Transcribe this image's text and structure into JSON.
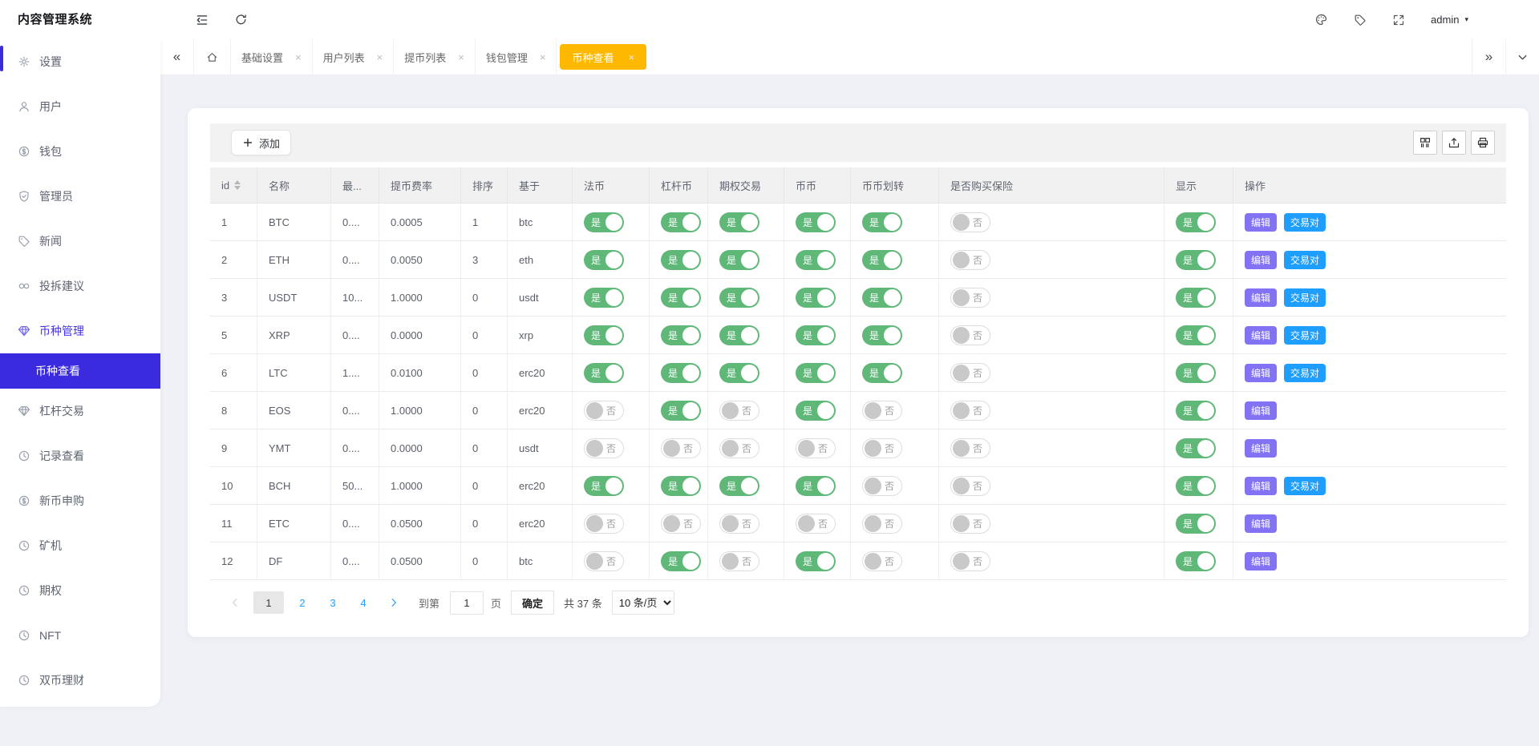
{
  "app": {
    "title": "内容管理系统",
    "user": "admin"
  },
  "header": {
    "left_icons": [
      {
        "icon": "collapse-icon"
      },
      {
        "icon": "refresh-icon"
      }
    ],
    "right_icons": [
      {
        "icon": "palette-icon"
      },
      {
        "icon": "tag-icon"
      },
      {
        "icon": "fullscreen-icon"
      }
    ]
  },
  "tabbar": {
    "tabs": [
      {
        "key": "basic-settings",
        "label": "基础设置",
        "active": false
      },
      {
        "key": "user-list",
        "label": "用户列表",
        "active": false
      },
      {
        "key": "withdraw-list",
        "label": "提币列表",
        "active": false
      },
      {
        "key": "wallet-manage",
        "label": "钱包管理",
        "active": false
      },
      {
        "key": "coin-view",
        "label": "币种查看",
        "active": true
      }
    ]
  },
  "sidebar": {
    "items": [
      {
        "key": "settings",
        "icon": "gear-icon",
        "label": "设置"
      },
      {
        "key": "users",
        "icon": "user-icon",
        "label": "用户"
      },
      {
        "key": "wallet",
        "icon": "dollar-circle-icon",
        "label": "钱包"
      },
      {
        "key": "admins",
        "icon": "shield-check-icon",
        "label": "管理员"
      },
      {
        "key": "news",
        "icon": "tag-icon",
        "label": "新闻"
      },
      {
        "key": "suggestions",
        "icon": "link-icon",
        "label": "投拆建议"
      },
      {
        "key": "coin-manage",
        "icon": "diamond-icon",
        "label": "币种管理",
        "active_parent": true,
        "children": [
          {
            "key": "coin-view",
            "label": "币种查看",
            "active": true
          }
        ]
      },
      {
        "key": "leverage-trade",
        "icon": "diamond-icon",
        "label": "杠杆交易"
      },
      {
        "key": "records",
        "icon": "clock-icon",
        "label": "记录查看"
      },
      {
        "key": "new-coin",
        "icon": "dollar-circle-icon",
        "label": "新币申购"
      },
      {
        "key": "miner",
        "icon": "clock-icon",
        "label": "矿机"
      },
      {
        "key": "options",
        "icon": "clock-icon",
        "label": "期权"
      },
      {
        "key": "nft",
        "icon": "clock-icon",
        "label": "NFT"
      },
      {
        "key": "dual-finance",
        "icon": "clock-icon",
        "label": "双币理财"
      }
    ]
  },
  "toolbar": {
    "add_label": "添加",
    "right_icons": [
      "columns-icon",
      "export-icon",
      "print-icon"
    ]
  },
  "table": {
    "columns": [
      "id",
      "名称",
      "最...",
      "提币费率",
      "排序",
      "基于",
      "法币",
      "杠杆币",
      "期权交易",
      "币币",
      "币币划转",
      "是否购买保险",
      "显示",
      "操作"
    ],
    "toggle_on": "是",
    "toggle_off": "否",
    "op_labels": {
      "edit": "编辑",
      "pairs": "交易对"
    },
    "rows": [
      {
        "id": "1",
        "name": "BTC",
        "max": "0....",
        "fee": "0.0005",
        "sort": "1",
        "base": "btc",
        "fiat": true,
        "lever": true,
        "option": true,
        "spot": true,
        "transfer": true,
        "insurance": false,
        "show": true,
        "ops": [
          "编辑",
          "交易对"
        ]
      },
      {
        "id": "2",
        "name": "ETH",
        "max": "0....",
        "fee": "0.0050",
        "sort": "3",
        "base": "eth",
        "fiat": true,
        "lever": true,
        "option": true,
        "spot": true,
        "transfer": true,
        "insurance": false,
        "show": true,
        "ops": [
          "编辑",
          "交易对"
        ]
      },
      {
        "id": "3",
        "name": "USDT",
        "max": "10...",
        "fee": "1.0000",
        "sort": "0",
        "base": "usdt",
        "fiat": true,
        "lever": true,
        "option": true,
        "spot": true,
        "transfer": true,
        "insurance": false,
        "show": true,
        "ops": [
          "编辑",
          "交易对"
        ]
      },
      {
        "id": "5",
        "name": "XRP",
        "max": "0....",
        "fee": "0.0000",
        "sort": "0",
        "base": "xrp",
        "fiat": true,
        "lever": true,
        "option": true,
        "spot": true,
        "transfer": true,
        "insurance": false,
        "show": true,
        "ops": [
          "编辑",
          "交易对"
        ]
      },
      {
        "id": "6",
        "name": "LTC",
        "max": "1....",
        "fee": "0.0100",
        "sort": "0",
        "base": "erc20",
        "fiat": true,
        "lever": true,
        "option": true,
        "spot": true,
        "transfer": true,
        "insurance": false,
        "show": true,
        "ops": [
          "编辑",
          "交易对"
        ]
      },
      {
        "id": "8",
        "name": "EOS",
        "max": "0....",
        "fee": "1.0000",
        "sort": "0",
        "base": "erc20",
        "fiat": false,
        "lever": true,
        "option": false,
        "spot": true,
        "transfer": false,
        "insurance": false,
        "show": true,
        "ops": [
          "编辑"
        ]
      },
      {
        "id": "9",
        "name": "YMT",
        "max": "0....",
        "fee": "0.0000",
        "sort": "0",
        "base": "usdt",
        "fiat": false,
        "lever": false,
        "option": false,
        "spot": false,
        "transfer": false,
        "insurance": false,
        "show": true,
        "ops": [
          "编辑"
        ]
      },
      {
        "id": "10",
        "name": "BCH",
        "max": "50...",
        "fee": "1.0000",
        "sort": "0",
        "base": "erc20",
        "fiat": true,
        "lever": true,
        "option": true,
        "spot": true,
        "transfer": false,
        "insurance": false,
        "show": true,
        "ops": [
          "编辑",
          "交易对"
        ]
      },
      {
        "id": "11",
        "name": "ETC",
        "max": "0....",
        "fee": "0.0500",
        "sort": "0",
        "base": "erc20",
        "fiat": false,
        "lever": false,
        "option": false,
        "spot": false,
        "transfer": false,
        "insurance": false,
        "show": true,
        "ops": [
          "编辑"
        ]
      },
      {
        "id": "12",
        "name": "DF",
        "max": "0....",
        "fee": "0.0500",
        "sort": "0",
        "base": "btc",
        "fiat": false,
        "lever": true,
        "option": false,
        "spot": true,
        "transfer": false,
        "insurance": false,
        "show": true,
        "ops": [
          "编辑"
        ]
      }
    ]
  },
  "pagination": {
    "pages": [
      "1",
      "2",
      "3",
      "4"
    ],
    "current": "1",
    "goto_label": "到第",
    "goto_value": "1",
    "page_label": "页",
    "confirm_label": "确定",
    "total_label": "共 37 条",
    "size_label": "10 条/页"
  },
  "colors": {
    "active_tab": "#ffb800",
    "sidebar_active": "#3b2bdf",
    "toggle_on": "#5FB878",
    "edit_button": "#8273f5",
    "pairs_button": "#1e9fff"
  }
}
